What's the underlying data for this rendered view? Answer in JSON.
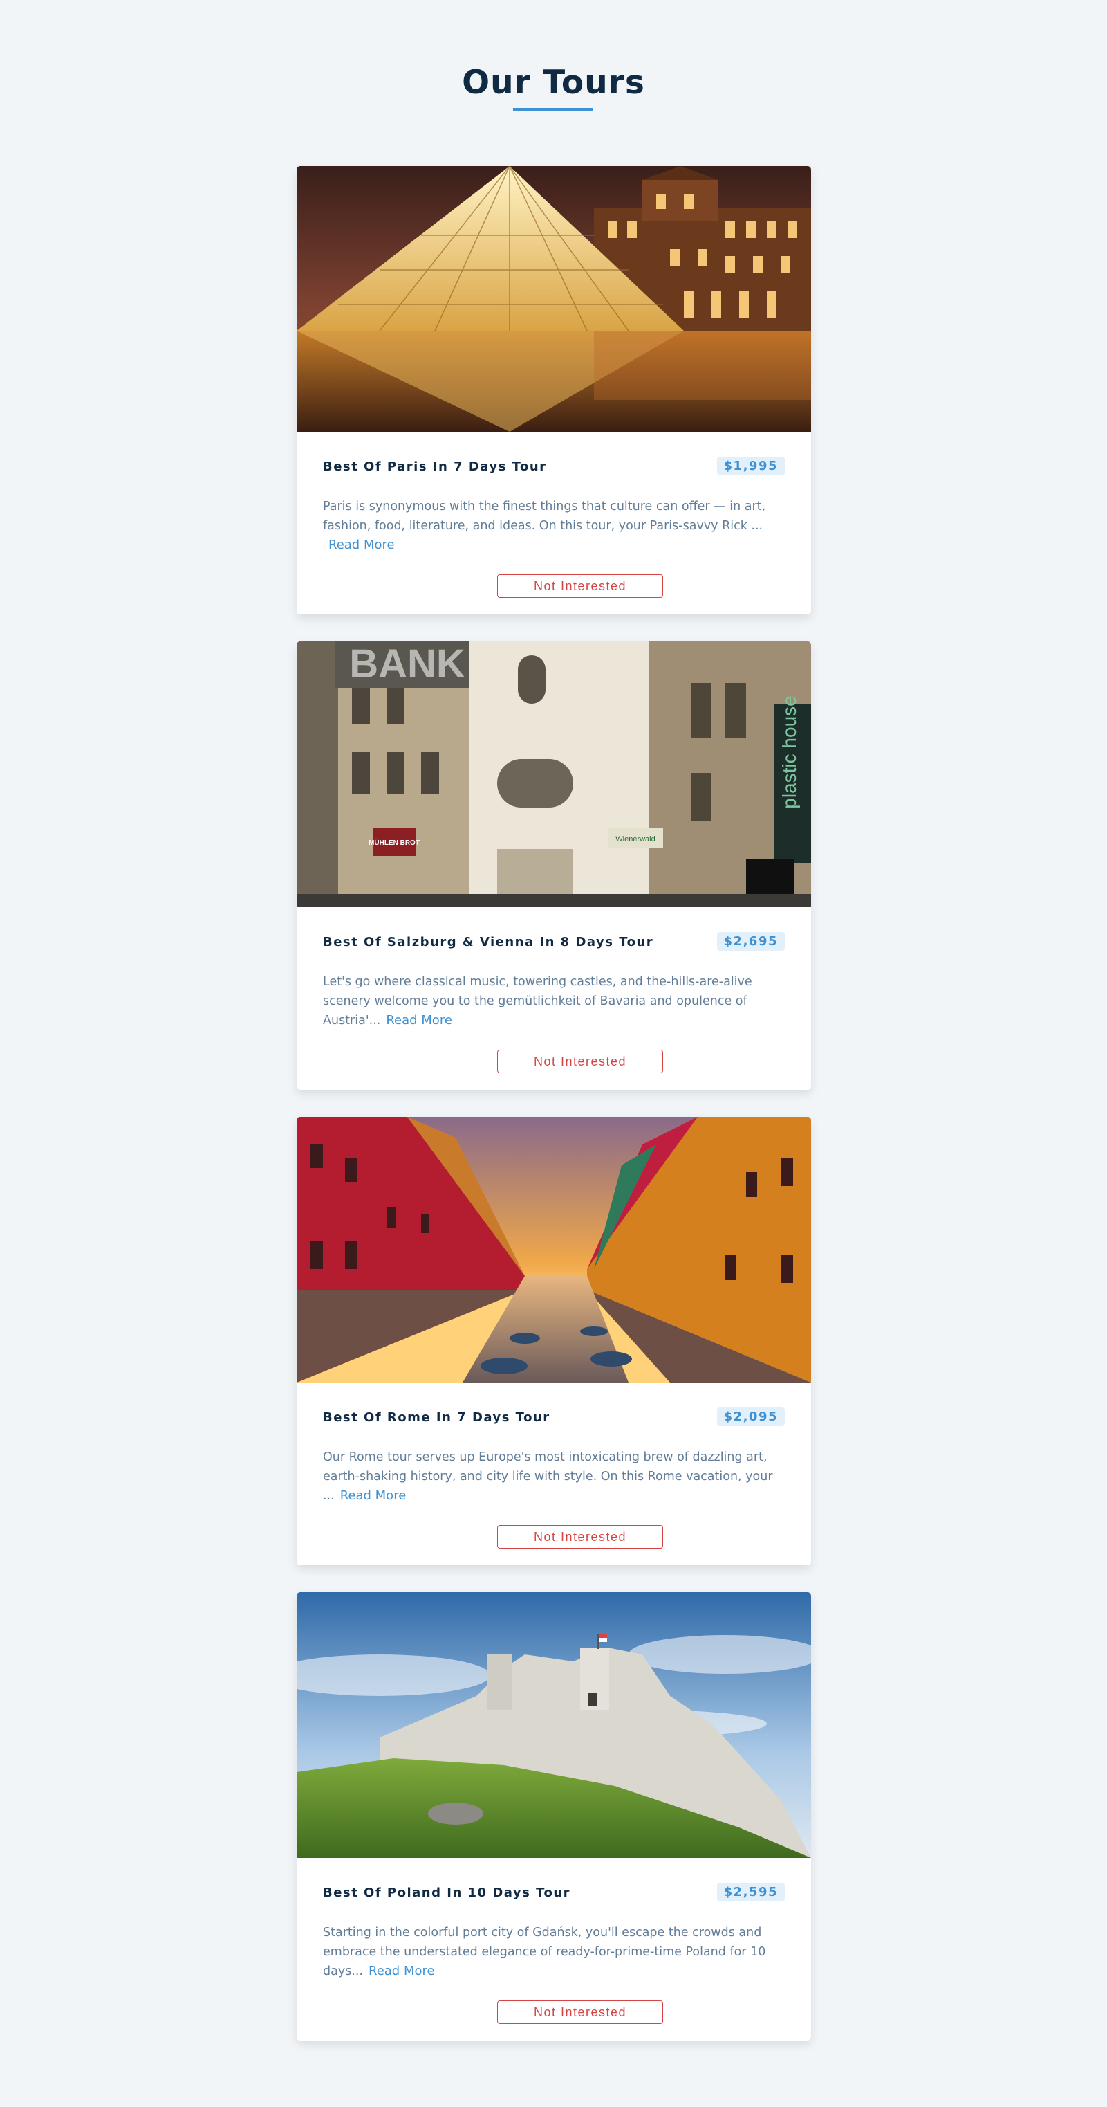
{
  "page": {
    "title": "Our Tours",
    "accent_color": "#3e91d2",
    "danger_color": "#d64545"
  },
  "tours": [
    {
      "name": "Best Of Paris In 7 Days Tour",
      "price": "$1,995",
      "description": "Paris is synonymous with the finest things that culture can offer — in art, fashion, food, literature, and ideas. On this tour, your Paris-savvy Rick ...",
      "read_more": "Read More",
      "not_interested": "Not Interested",
      "image_alt": "Louvre pyramid at night"
    },
    {
      "name": "Best Of Salzburg & Vienna In 8 Days Tour",
      "price": "$2,695",
      "description": "Let's go where classical music, towering castles, and the-hills-are-alive scenery welcome you to the gemütlichkeit of Bavaria and opulence of Austria'...",
      "read_more": "Read More",
      "not_interested": "Not Interested",
      "image_alt": "Vienna street with shop signs",
      "sign_texts": [
        "BANK",
        "plastic house",
        "MÜHLEN BROT",
        "Wienerwald"
      ]
    },
    {
      "name": "Best Of Rome In 7 Days Tour",
      "price": "$2,095",
      "description": "Our Rome tour serves up Europe's most intoxicating brew of dazzling art, earth-shaking history, and city life with style. On this Rome vacation, your ...",
      "read_more": "Read More",
      "not_interested": "Not Interested",
      "image_alt": "Colorful canal houses at sunset"
    },
    {
      "name": "Best Of Poland In 10 Days Tour",
      "price": "$2,595",
      "description": "Starting in the colorful port city of Gdańsk, you'll escape the crowds and embrace the understated elegance of ready-for-prime-time Poland for 10 days...",
      "read_more": "Read More",
      "not_interested": "Not Interested",
      "image_alt": "Castle ruins on a grassy hill"
    }
  ]
}
